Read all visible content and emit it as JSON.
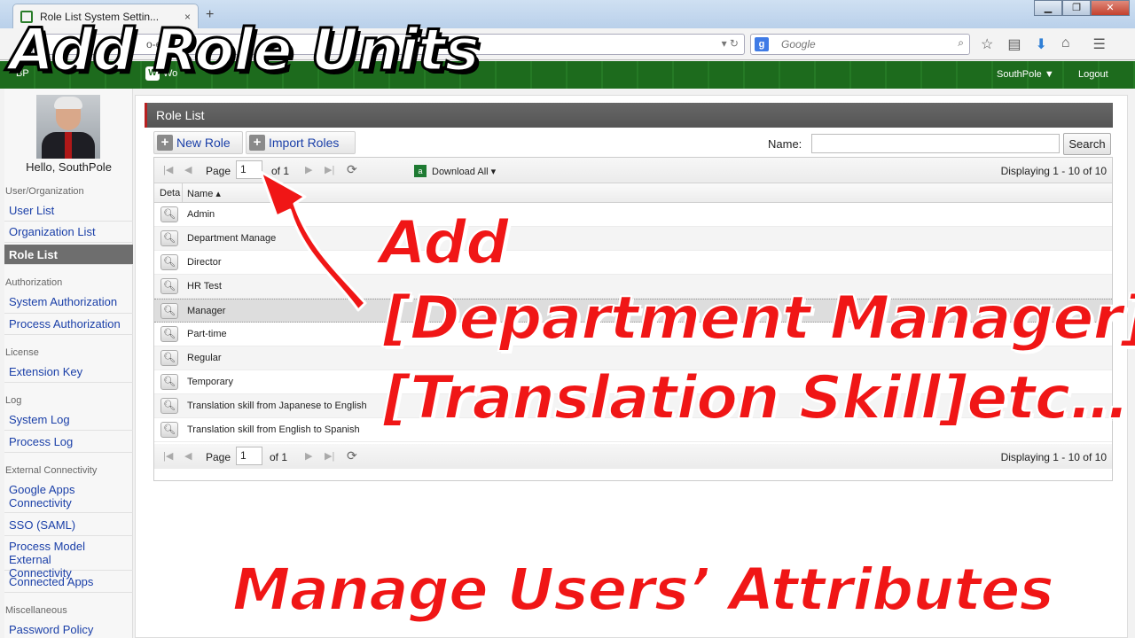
{
  "browser": {
    "tab_title": "Role List System Settin...",
    "tab_close": "×",
    "new_tab": "+",
    "url_text": "o-en.",
    "search_engine_badge": "g",
    "search_placeholder": "Google",
    "window_buttons": [
      "▁",
      "❐",
      "✕"
    ]
  },
  "app_header": {
    "brand": "BP",
    "workflow_label": "Wo",
    "user_menu": "SouthPole ▼",
    "logout": "Logout"
  },
  "sidebar": {
    "greeting": "Hello, SouthPole",
    "sections": {
      "user_org": "User/Organization",
      "authorization": "Authorization",
      "license": "License",
      "log": "Log",
      "external": "External Connectivity",
      "misc": "Miscellaneous"
    },
    "items": {
      "user_list": "User List",
      "org_list": "Organization List",
      "role_list": "Role List",
      "system_auth": "System Authorization",
      "process_auth": "Process Authorization",
      "extension_key": "Extension Key",
      "system_log": "System Log",
      "process_log": "Process Log",
      "google_apps_1": "Google Apps",
      "google_apps_2": "Connectivity",
      "sso": "SSO (SAML)",
      "pmec_1": "Process Model External",
      "pmec_2": "Connectivity",
      "connected_apps": "Connected Apps",
      "password_policy": "Password Policy"
    }
  },
  "main": {
    "panel_title": "Role List",
    "new_role": "New Role",
    "import_roles": "Import Roles",
    "name_label": "Name:",
    "search_button": "Search",
    "pager": {
      "page_label": "Page",
      "page_value": "1",
      "of_label": "of 1",
      "download_all": "Download All ▾",
      "displaying": "Displaying 1 - 10 of 10"
    },
    "columns": {
      "detail": "Deta",
      "name": "Name ▴"
    },
    "roles": [
      "Admin",
      "Department Manage",
      "Director",
      "HR Test",
      "Manager",
      "Part-time",
      "Regular",
      "Temporary",
      "Translation skill from Japanese to English",
      "Translation skill from English to Spanish"
    ]
  },
  "overlay": {
    "title": "Add Role Units",
    "line1": "Add",
    "line2": "[Department Manager]",
    "line3": "[Translation Skill]etc…",
    "bottom": "Manage Users’ Attributes"
  },
  "colors": {
    "header_green": "#1d6b1d",
    "overlay_red": "#f01616",
    "panel_title_bg": "#5e5e5e",
    "link_blue": "#1a3fa8"
  },
  "icons": [
    "back-icon",
    "reload-icon",
    "search-icon",
    "star-icon",
    "reading-list-icon",
    "download-icon",
    "home-icon",
    "menu-icon",
    "magnifier-icon",
    "plus-icon",
    "excel-icon",
    "refresh-icon"
  ]
}
